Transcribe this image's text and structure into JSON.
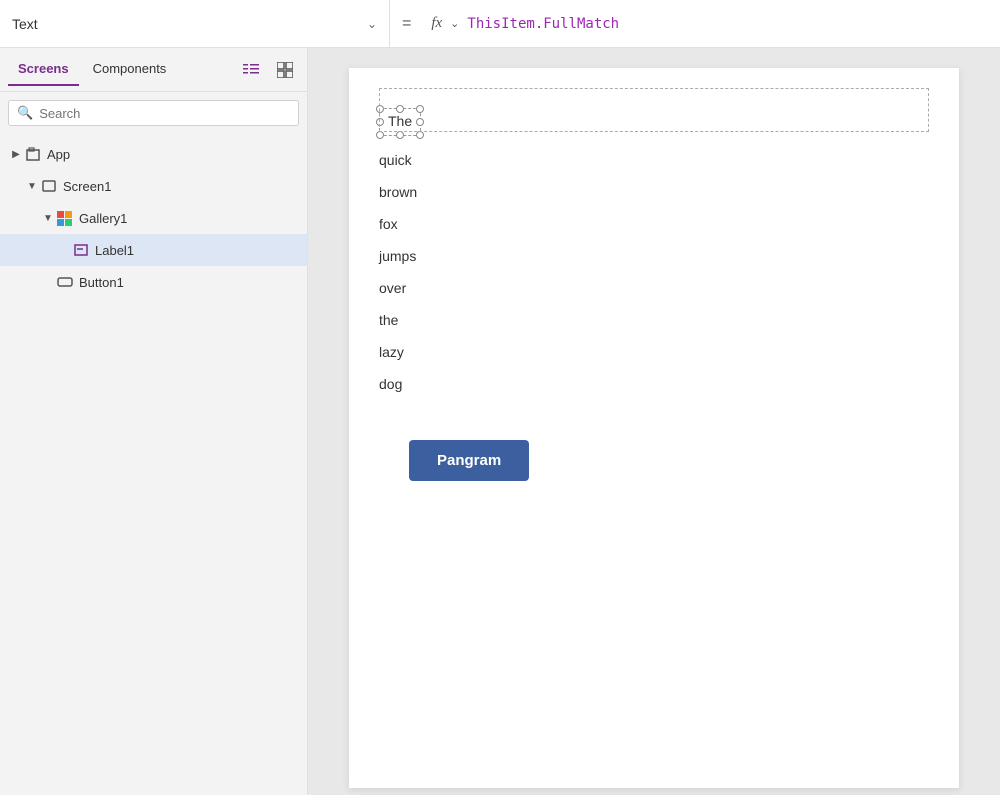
{
  "topbar": {
    "property_label": "Text",
    "equals_sign": "=",
    "fx_label": "fx",
    "formula_chevron": "∨",
    "formula_value": "ThisItem.FullMatch"
  },
  "sidebar": {
    "tab_screens": "Screens",
    "tab_components": "Components",
    "search_placeholder": "Search",
    "tree_items": [
      {
        "id": "app",
        "label": "App",
        "level": 0,
        "icon": "app",
        "expandable": true,
        "expanded": false
      },
      {
        "id": "screen1",
        "label": "Screen1",
        "level": 1,
        "icon": "screen",
        "expandable": true,
        "expanded": true
      },
      {
        "id": "gallery1",
        "label": "Gallery1",
        "level": 2,
        "icon": "gallery",
        "expandable": true,
        "expanded": true
      },
      {
        "id": "label1",
        "label": "Label1",
        "level": 3,
        "icon": "label",
        "expandable": false,
        "selected": true
      },
      {
        "id": "button1",
        "label": "Button1",
        "level": 2,
        "icon": "button",
        "expandable": false
      }
    ]
  },
  "canvas": {
    "selected_label_text": "The",
    "gallery_items": [
      "quick",
      "brown",
      "fox",
      "jumps",
      "over",
      "the",
      "lazy",
      "dog"
    ],
    "button_label": "Pangram"
  }
}
